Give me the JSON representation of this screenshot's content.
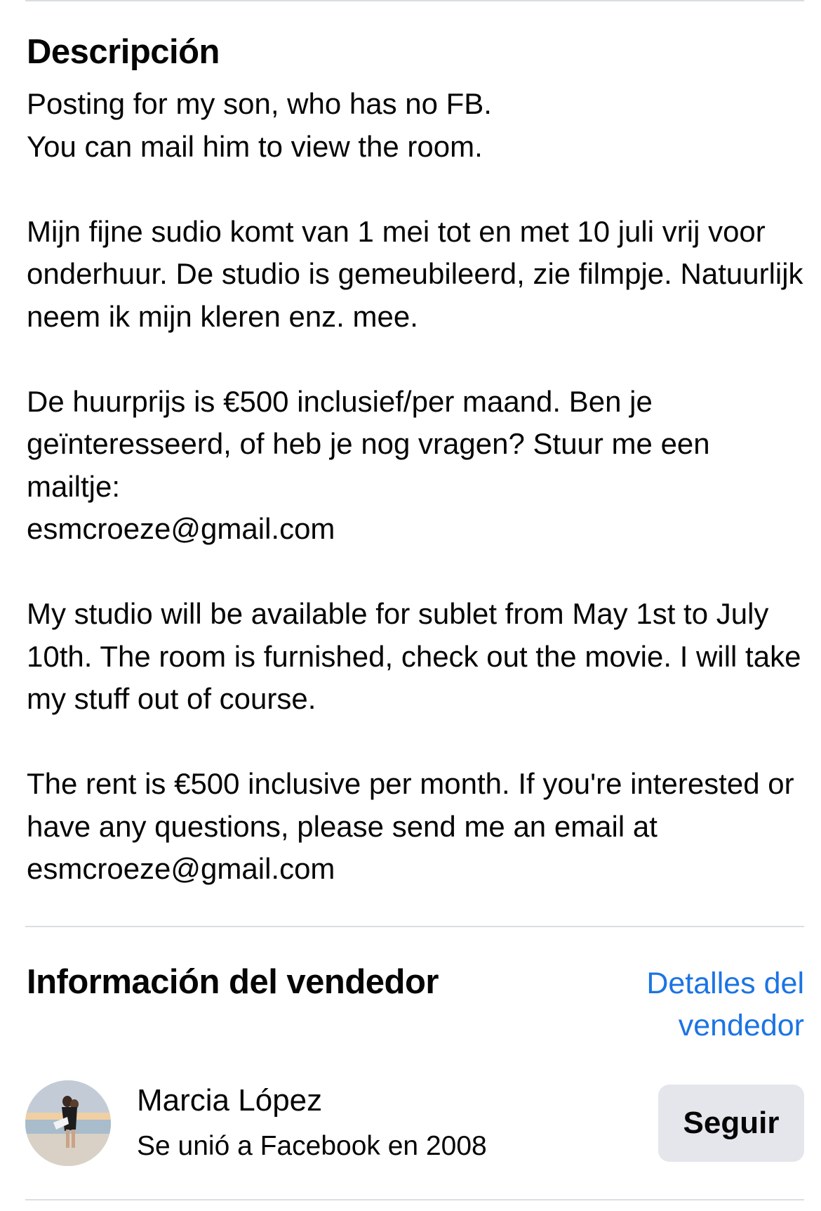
{
  "description": {
    "heading": "Descripción",
    "body": "Posting for my son, who has no FB.\nYou can mail him to view the room.\n\nMijn fijne sudio komt van 1 mei tot en met 10 juli vrij voor onderhuur. De studio is gemeubileerd, zie filmpje. Natuurlijk neem ik mijn kleren enz. mee.\n\nDe huurprijs is €500 inclusief/per maand. Ben je geïnteresseerd, of heb je nog vragen? Stuur me een mailtje:\nesmcroeze@gmail.com\n\nMy studio will be available for sublet from May 1st to July 10th. The room is furnished, check out the movie. I will take my stuff out of course.\n\nThe rent is €500 inclusive per month. If you're interested or have any questions, please send me an email at esmcroeze@gmail.com"
  },
  "seller": {
    "heading": "Información del vendedor",
    "details_link": "Detalles del vendedor",
    "name": "Marcia López",
    "joined": "Se unió a Facebook en 2008",
    "follow_label": "Seguir",
    "avatar_icon": "profile-photo"
  },
  "colors": {
    "link": "#1b74e4",
    "button_bg": "#e4e6eb",
    "divider": "#dadde1",
    "text": "#050505"
  }
}
